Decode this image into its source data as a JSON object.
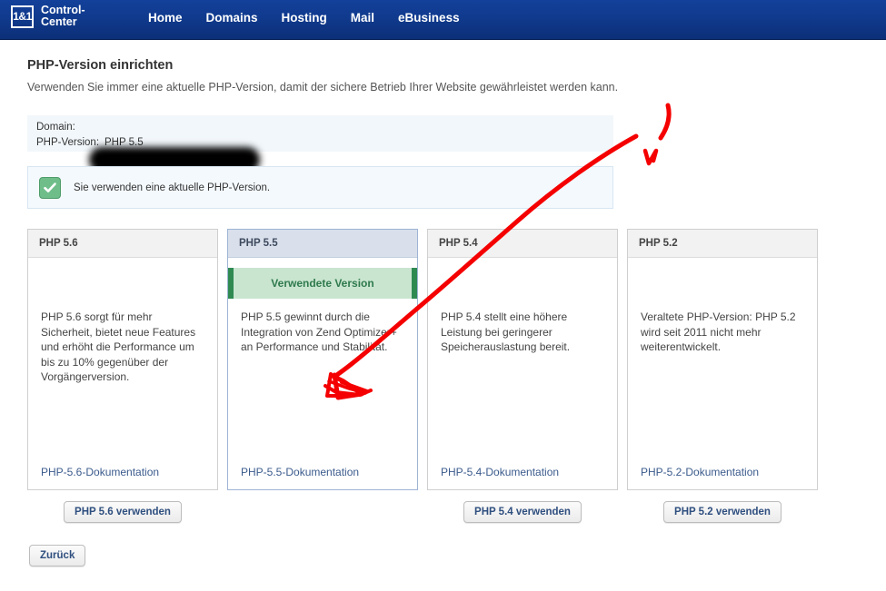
{
  "navbar": {
    "logo_text": "1&1",
    "brand_title": "Control-\nCenter",
    "items": [
      {
        "label": "Home"
      },
      {
        "label": "Domains"
      },
      {
        "label": "Hosting"
      },
      {
        "label": "Mail"
      },
      {
        "label": "eBusiness"
      }
    ]
  },
  "page": {
    "title": "PHP-Version einrichten",
    "subtitle": "Verwenden Sie immer eine aktuelle PHP-Version, damit der sichere Betrieb Ihrer Website gewährleistet werden kann."
  },
  "info_panel": {
    "domain_label": "Domain:",
    "domain_value": "",
    "php_label": "PHP-Version:",
    "php_value": "PHP 5.5"
  },
  "notice": {
    "icon": "check-icon",
    "text": "Sie verwenden eine aktuelle PHP-Version.",
    "icon_color": "#6fbe8a"
  },
  "cards": [
    {
      "title": "PHP 5.6",
      "badge": "",
      "description": "PHP 5.6 sorgt für mehr Sicherheit, bietet neue Features und erhöht die Performance um bis zu 10% gegenüber der Vorgängerversion.",
      "doc_link": "PHP-5.6-Dokumentation",
      "button": "PHP 5.6 verwenden",
      "active": false
    },
    {
      "title": "PHP 5.5",
      "badge": "Verwendete Version",
      "description": "PHP 5.5 gewinnt durch die Integration von Zend Optimizer+ an Performance und Stabilität.",
      "doc_link": "PHP-5.5-Dokumentation",
      "button": "",
      "active": true
    },
    {
      "title": "PHP 5.4",
      "badge": "",
      "description": "PHP 5.4 stellt eine höhere Leistung bei geringerer Speicherauslastung bereit.",
      "doc_link": "PHP-5.4-Dokumentation",
      "button": "PHP 5.4 verwenden",
      "active": false
    },
    {
      "title": "PHP 5.2",
      "badge": "",
      "description": "Veraltete PHP-Version: PHP 5.2 wird seit 2011 nicht mehr weiterentwickelt.",
      "doc_link": "PHP-5.2-Dokumentation",
      "button": "PHP 5.2 verwenden",
      "active": false
    }
  ],
  "footer": {
    "back_button": "Zurück"
  },
  "annotation": {
    "color": "#f50000",
    "description": "hand-drawn red arrow pointing from upper right to the PHP 5.5 card"
  },
  "colors": {
    "navbar_top": "#13409a",
    "navbar_bottom": "#0c2f78",
    "accent_green": "#2f8a52",
    "badge_bg": "#c9e5cf",
    "active_head": "#d9e0ec",
    "link": "#3b5b8c"
  }
}
